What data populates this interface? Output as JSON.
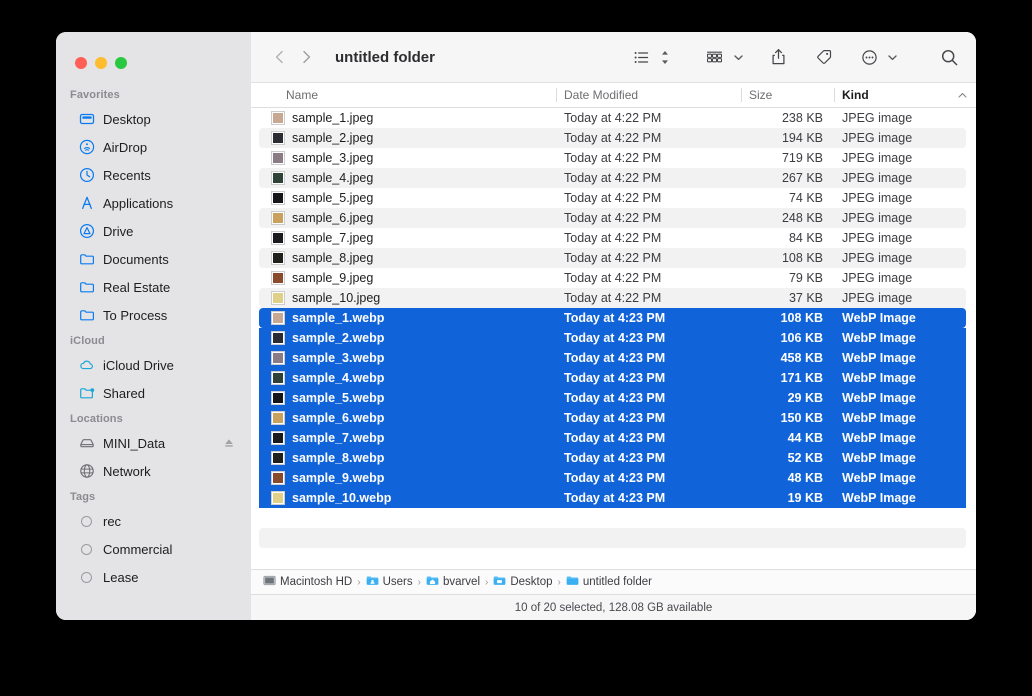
{
  "window": {
    "title": "untitled folder"
  },
  "traffic_lights": [
    {
      "name": "close",
      "color": "#ff5f57"
    },
    {
      "name": "minimize",
      "color": "#febc2e"
    },
    {
      "name": "maximize",
      "color": "#28c840"
    }
  ],
  "sidebar": {
    "sections": [
      {
        "header": "Favorites",
        "items": [
          {
            "label": "Desktop",
            "icon": "desktop-icon"
          },
          {
            "label": "AirDrop",
            "icon": "airdrop-icon"
          },
          {
            "label": "Recents",
            "icon": "clock-icon"
          },
          {
            "label": "Applications",
            "icon": "applications-icon"
          },
          {
            "label": "Drive",
            "icon": "drive-icon"
          },
          {
            "label": "Documents",
            "icon": "folder-icon"
          },
          {
            "label": "Real Estate",
            "icon": "folder-icon"
          },
          {
            "label": "To Process",
            "icon": "folder-icon"
          }
        ]
      },
      {
        "header": "iCloud",
        "items": [
          {
            "label": "iCloud Drive",
            "icon": "cloud-icon"
          },
          {
            "label": "Shared",
            "icon": "shared-folder-icon"
          }
        ]
      },
      {
        "header": "Locations",
        "items": [
          {
            "label": "MINI_Data",
            "icon": "external-disk-icon",
            "eject": true
          },
          {
            "label": "Network",
            "icon": "globe-icon"
          }
        ]
      },
      {
        "header": "Tags",
        "items": [
          {
            "label": "rec",
            "icon": "tag-circle-icon"
          },
          {
            "label": "Commercial",
            "icon": "tag-circle-icon"
          },
          {
            "label": "Lease",
            "icon": "tag-circle-icon"
          }
        ]
      }
    ]
  },
  "toolbar": {
    "back": "‹",
    "forward": "›",
    "buttons": [
      {
        "name": "list-view-icon",
        "label": "List view"
      },
      {
        "name": "view-stepper-icon",
        "label": "View options"
      },
      {
        "name": "group-by-icon",
        "label": "Group"
      },
      {
        "name": "group-chevron-icon",
        "label": "Group menu"
      },
      {
        "name": "share-icon",
        "label": "Share"
      },
      {
        "name": "tag-icon",
        "label": "Tags"
      },
      {
        "name": "more-icon",
        "label": "More"
      },
      {
        "name": "more-chevron-icon",
        "label": "More menu"
      },
      {
        "name": "search-icon",
        "label": "Search"
      }
    ]
  },
  "columns": [
    {
      "key": "name",
      "label": "Name",
      "sorted": false
    },
    {
      "key": "date",
      "label": "Date Modified",
      "sorted": false
    },
    {
      "key": "size",
      "label": "Size",
      "sorted": false
    },
    {
      "key": "kind",
      "label": "Kind",
      "sorted": true,
      "direction": "ascending"
    }
  ],
  "files": [
    {
      "name": "sample_1.jpeg",
      "date": "Today at 4:22 PM",
      "size": "238 KB",
      "kind": "JPEG image",
      "selected": false,
      "swatch": "#c8a893"
    },
    {
      "name": "sample_2.jpeg",
      "date": "Today at 4:22 PM",
      "size": "194 KB",
      "kind": "JPEG image",
      "selected": false,
      "swatch": "#2b2b33"
    },
    {
      "name": "sample_3.jpeg",
      "date": "Today at 4:22 PM",
      "size": "719 KB",
      "kind": "JPEG image",
      "selected": false,
      "swatch": "#8b7b84"
    },
    {
      "name": "sample_4.jpeg",
      "date": "Today at 4:22 PM",
      "size": "267 KB",
      "kind": "JPEG image",
      "selected": false,
      "swatch": "#2e4238"
    },
    {
      "name": "sample_5.jpeg",
      "date": "Today at 4:22 PM",
      "size": "74 KB",
      "kind": "JPEG image",
      "selected": false,
      "swatch": "#16161a"
    },
    {
      "name": "sample_6.jpeg",
      "date": "Today at 4:22 PM",
      "size": "248 KB",
      "kind": "JPEG image",
      "selected": false,
      "swatch": "#c9a05c"
    },
    {
      "name": "sample_7.jpeg",
      "date": "Today at 4:22 PM",
      "size": "84 KB",
      "kind": "JPEG image",
      "selected": false,
      "swatch": "#1b1b1f"
    },
    {
      "name": "sample_8.jpeg",
      "date": "Today at 4:22 PM",
      "size": "108 KB",
      "kind": "JPEG image",
      "selected": false,
      "swatch": "#20201d"
    },
    {
      "name": "sample_9.jpeg",
      "date": "Today at 4:22 PM",
      "size": "79 KB",
      "kind": "JPEG image",
      "selected": false,
      "swatch": "#8a4a2c"
    },
    {
      "name": "sample_10.jpeg",
      "date": "Today at 4:22 PM",
      "size": "37 KB",
      "kind": "JPEG image",
      "selected": false,
      "swatch": "#e0cf86"
    },
    {
      "name": "sample_1.webp",
      "date": "Today at 4:23 PM",
      "size": "108 KB",
      "kind": "WebP Image",
      "selected": true,
      "swatch": "#c8a893"
    },
    {
      "name": "sample_2.webp",
      "date": "Today at 4:23 PM",
      "size": "106 KB",
      "kind": "WebP Image",
      "selected": true,
      "swatch": "#2b2b33"
    },
    {
      "name": "sample_3.webp",
      "date": "Today at 4:23 PM",
      "size": "458 KB",
      "kind": "WebP Image",
      "selected": true,
      "swatch": "#8b7b84"
    },
    {
      "name": "sample_4.webp",
      "date": "Today at 4:23 PM",
      "size": "171 KB",
      "kind": "WebP Image",
      "selected": true,
      "swatch": "#2e4238"
    },
    {
      "name": "sample_5.webp",
      "date": "Today at 4:23 PM",
      "size": "29 KB",
      "kind": "WebP Image",
      "selected": true,
      "swatch": "#16161a"
    },
    {
      "name": "sample_6.webp",
      "date": "Today at 4:23 PM",
      "size": "150 KB",
      "kind": "WebP Image",
      "selected": true,
      "swatch": "#c9a05c"
    },
    {
      "name": "sample_7.webp",
      "date": "Today at 4:23 PM",
      "size": "44 KB",
      "kind": "WebP Image",
      "selected": true,
      "swatch": "#1b1b1f"
    },
    {
      "name": "sample_8.webp",
      "date": "Today at 4:23 PM",
      "size": "52 KB",
      "kind": "WebP Image",
      "selected": true,
      "swatch": "#20201d"
    },
    {
      "name": "sample_9.webp",
      "date": "Today at 4:23 PM",
      "size": "48 KB",
      "kind": "WebP Image",
      "selected": true,
      "swatch": "#8a4a2c"
    },
    {
      "name": "sample_10.webp",
      "date": "Today at 4:23 PM",
      "size": "19 KB",
      "kind": "WebP Image",
      "selected": true,
      "swatch": "#e0cf86"
    }
  ],
  "path_bar": [
    {
      "label": "Macintosh HD",
      "icon": "hard-disk-icon"
    },
    {
      "label": "Users",
      "icon": "users-folder-icon"
    },
    {
      "label": "bvarvel",
      "icon": "home-folder-icon"
    },
    {
      "label": "Desktop",
      "icon": "desktop-folder-icon"
    },
    {
      "label": "untitled folder",
      "icon": "folder-icon"
    }
  ],
  "path_separator": "›",
  "status_bar": {
    "text": "10 of 20 selected, 128.08 GB available"
  },
  "colors": {
    "selection_blue": "#1063d8",
    "sidebar_bg": "#e4e4e6",
    "accent_icon_blue": "#0a7cf0"
  }
}
